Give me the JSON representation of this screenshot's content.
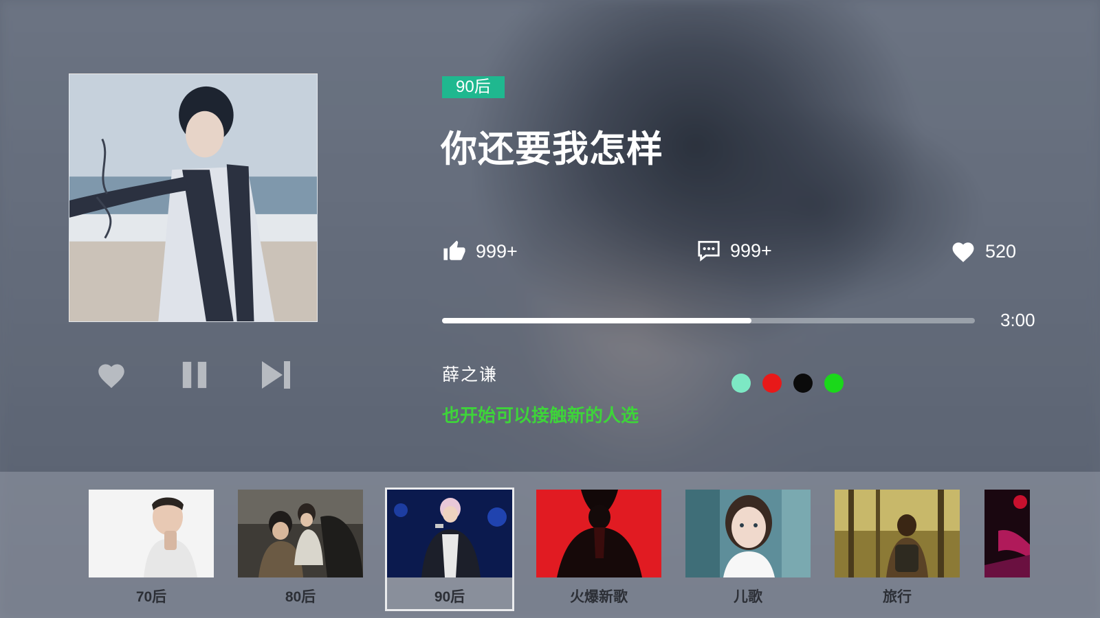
{
  "player": {
    "category_badge": "90后",
    "song_title": "你还要我怎样",
    "stats": {
      "likes": "999+",
      "comments": "999+",
      "favorites": "520"
    },
    "progress": {
      "fraction": 0.58,
      "duration": "3:00"
    },
    "artist": "薛之谦",
    "lyric": "也开始可以接触新的人选",
    "color_options": [
      "#7de8c4",
      "#e81919",
      "#0b0b0b",
      "#1ad81a"
    ],
    "controls": [
      "heart-icon",
      "pause-icon",
      "skip-next-icon"
    ]
  },
  "categories": [
    {
      "label": "70后",
      "selected": false
    },
    {
      "label": "80后",
      "selected": false
    },
    {
      "label": "90后",
      "selected": true
    },
    {
      "label": "火爆新歌",
      "selected": false
    },
    {
      "label": "儿歌",
      "selected": false
    },
    {
      "label": "旅行",
      "selected": false
    }
  ],
  "colors": {
    "badge": "#1fb88f",
    "lyric": "#3ed43a",
    "progress_fill": "#ffffff"
  }
}
